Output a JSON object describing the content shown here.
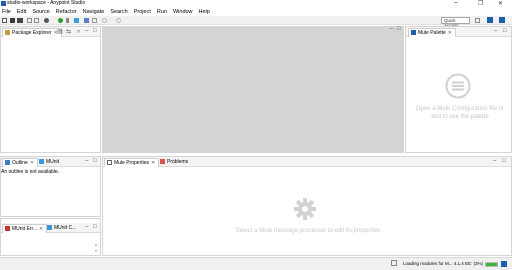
{
  "window": {
    "title": "studio-workspace - Anypoint Studio",
    "minimize": "–",
    "maximize": "❐",
    "close": "✕"
  },
  "menu": [
    "File",
    "Edit",
    "Source",
    "Refactor",
    "Navigate",
    "Search",
    "Project",
    "Run",
    "Window",
    "Help"
  ],
  "toolbar": {
    "quick_access_placeholder": "Quick Access"
  },
  "package_explorer": {
    "tab_label": "Package Explorer",
    "close": "✕"
  },
  "mule_palette": {
    "tab_label": "Mule Palette",
    "close": "✕",
    "hint": "Open a Mule Configuration file or test to see the palette"
  },
  "outline": {
    "tabs": [
      {
        "label": "Outline",
        "close": "✕"
      },
      {
        "label": "MUnit",
        "close": ""
      }
    ],
    "message": "An outline is not available."
  },
  "bottom_left": {
    "tabs": [
      {
        "label": "MUnit Err...",
        "close": "✕"
      },
      {
        "label": "MUnit C...",
        "close": ""
      }
    ]
  },
  "properties": {
    "tabs": [
      {
        "label": "Mule Properties",
        "close": "✕"
      },
      {
        "label": "Problems",
        "close": ""
      }
    ],
    "hint": "Select a Mule message processor to edit its properties"
  },
  "status": {
    "text": "Loading modules for M... 4.1.4 EE: (3%)"
  },
  "colors": {
    "editor_bg": "#d4d4d4",
    "accent_blue": "#1f5fa6",
    "progress": "#3cb43c",
    "munit_red": "#c0392b"
  }
}
